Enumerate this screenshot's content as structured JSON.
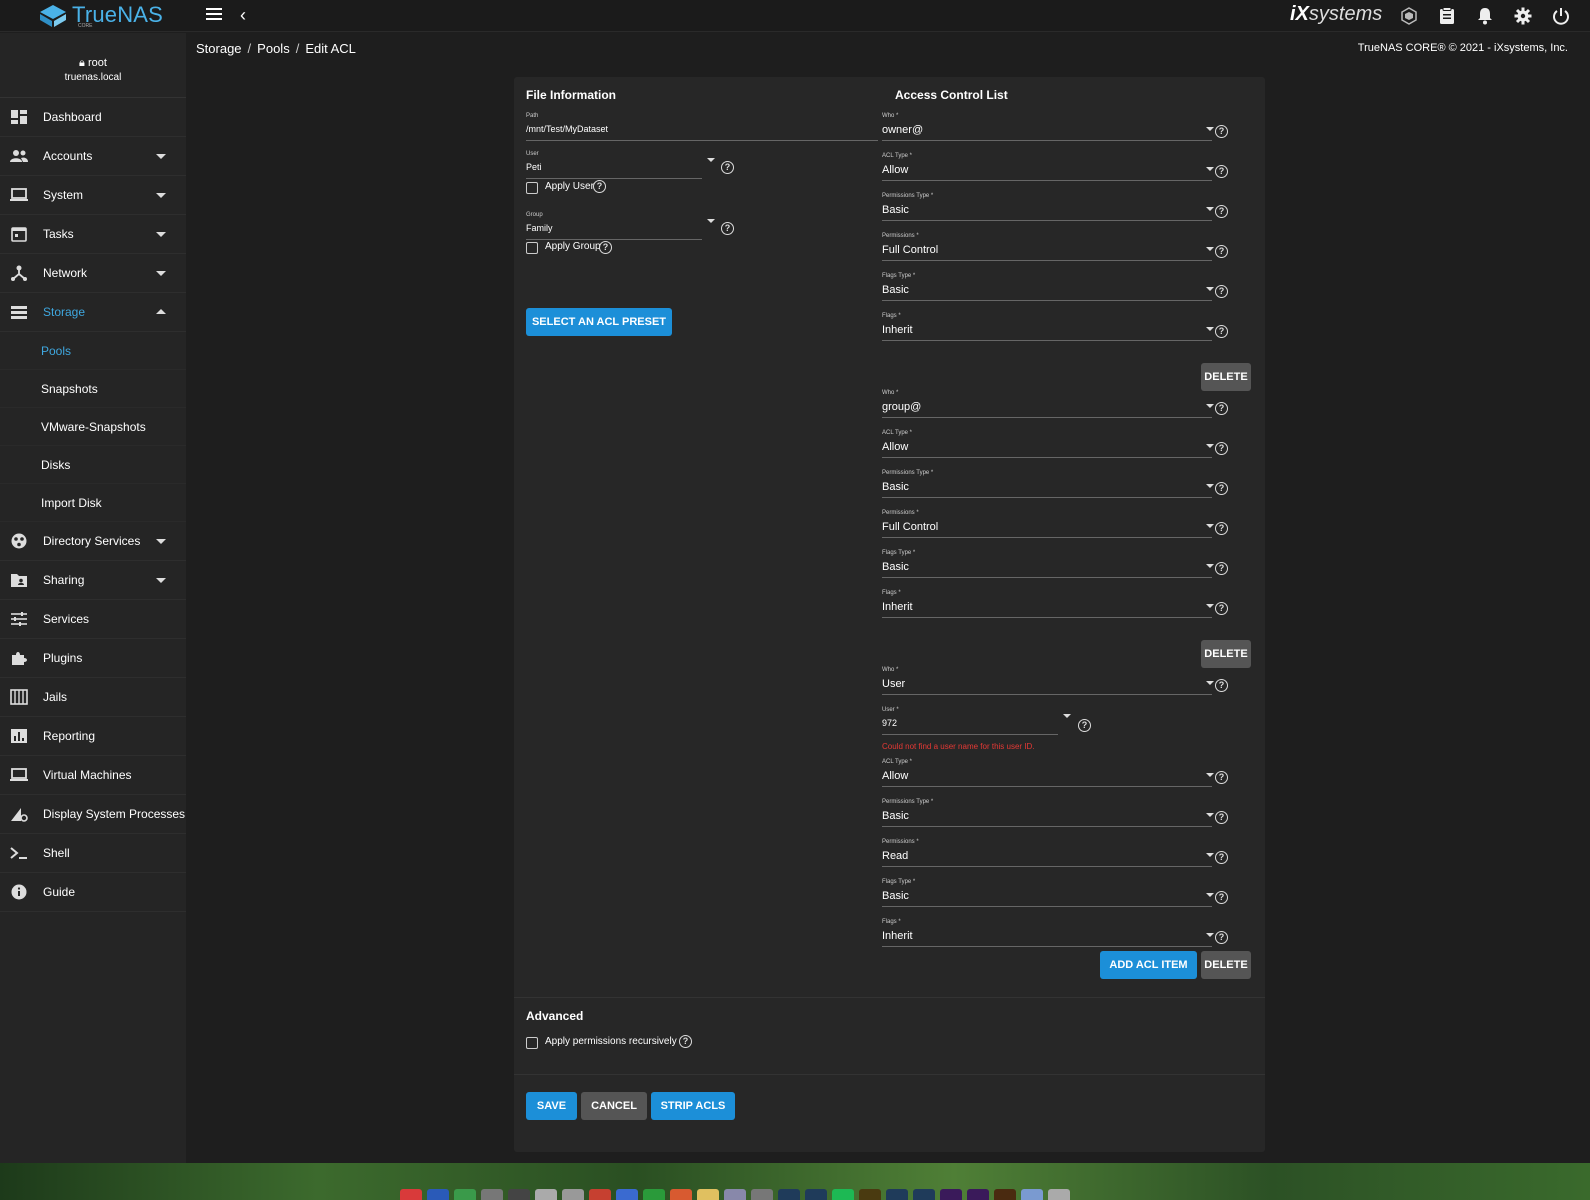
{
  "app": {
    "brand": "TrueNAS",
    "edition": "CORE",
    "vendor_logo": "iXsystems"
  },
  "header": {
    "breadcrumb": [
      "Storage",
      "Pools",
      "Edit ACL"
    ],
    "copyright": "TrueNAS CORE® © 2021 - iXsystems, Inc.",
    "icons": [
      "truecommand-icon",
      "clipboard-icon",
      "bell-icon",
      "gear-icon",
      "power-icon"
    ]
  },
  "user": {
    "name": "root",
    "host": "truenas.local"
  },
  "sidebar": {
    "items": [
      {
        "label": "Dashboard",
        "icon": "dashboard-icon",
        "expandable": false
      },
      {
        "label": "Accounts",
        "icon": "accounts-icon",
        "expandable": true
      },
      {
        "label": "System",
        "icon": "laptop-icon",
        "expandable": true
      },
      {
        "label": "Tasks",
        "icon": "calendar-icon",
        "expandable": true
      },
      {
        "label": "Network",
        "icon": "network-icon",
        "expandable": true
      },
      {
        "label": "Storage",
        "icon": "storage-icon",
        "expandable": true,
        "expanded": true,
        "active": true
      },
      {
        "label": "Directory Services",
        "icon": "directory-icon",
        "expandable": true
      },
      {
        "label": "Sharing",
        "icon": "folder-share-icon",
        "expandable": true
      },
      {
        "label": "Services",
        "icon": "sliders-icon",
        "expandable": false
      },
      {
        "label": "Plugins",
        "icon": "puzzle-icon",
        "expandable": false
      },
      {
        "label": "Jails",
        "icon": "jail-icon",
        "expandable": false
      },
      {
        "label": "Reporting",
        "icon": "chart-icon",
        "expandable": false
      },
      {
        "label": "Virtual Machines",
        "icon": "monitor-icon",
        "expandable": false
      },
      {
        "label": "Display System Processes",
        "icon": "processes-icon",
        "expandable": false
      },
      {
        "label": "Shell",
        "icon": "terminal-icon",
        "expandable": false
      },
      {
        "label": "Guide",
        "icon": "info-icon",
        "expandable": false
      }
    ],
    "storage_sub": [
      "Pools",
      "Snapshots",
      "VMware-Snapshots",
      "Disks",
      "Import Disk"
    ],
    "active_sub": "Pools"
  },
  "file_info": {
    "title": "File Information",
    "path": {
      "label": "Path",
      "value": "/mnt/Test/MyDataset"
    },
    "user": {
      "label": "User",
      "value": "Peti"
    },
    "apply_user": "Apply User",
    "group": {
      "label": "Group",
      "value": "Family"
    },
    "apply_group": "Apply Group",
    "preset_button": "SELECT AN ACL PRESET"
  },
  "acl": {
    "title": "Access Control List",
    "labels": {
      "who": "Who *",
      "acl_type": "ACL Type *",
      "perm_type": "Permissions Type *",
      "perms": "Permissions *",
      "flags_type": "Flags Type *",
      "flags": "Flags *",
      "user": "User *"
    },
    "entries": [
      {
        "who": "owner@",
        "acl_type": "Allow",
        "perm_type": "Basic",
        "perms": "Full Control",
        "flags_type": "Basic",
        "flags": "Inherit"
      },
      {
        "who": "group@",
        "acl_type": "Allow",
        "perm_type": "Basic",
        "perms": "Full Control",
        "flags_type": "Basic",
        "flags": "Inherit"
      },
      {
        "who": "User",
        "user": "972",
        "user_error": "Could not find a user name for this user ID.",
        "acl_type": "Allow",
        "perm_type": "Basic",
        "perms": "Read",
        "flags_type": "Basic",
        "flags": "Inherit"
      }
    ],
    "delete_label": "DELETE",
    "add_label": "ADD ACL ITEM"
  },
  "advanced": {
    "title": "Advanced",
    "recursive": "Apply permissions recursively"
  },
  "actions": {
    "save": "SAVE",
    "cancel": "CANCEL",
    "strip": "STRIP ACLS"
  },
  "colors": {
    "accent": "#1c8fd8",
    "active_nav": "#3fa8e0",
    "error": "#e53935",
    "background": "#1e1e1e",
    "card": "#272727"
  }
}
